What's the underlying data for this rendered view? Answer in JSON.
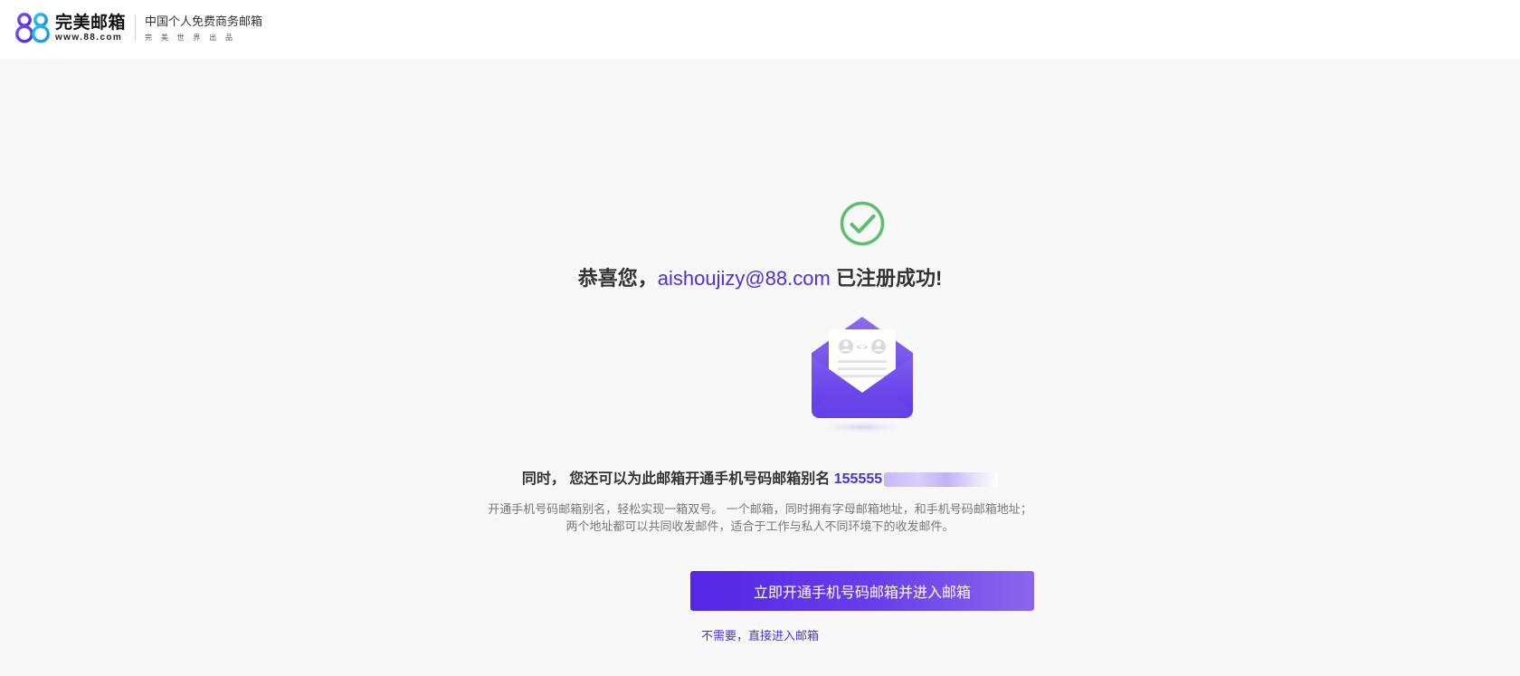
{
  "header": {
    "logo_mark": "88",
    "logo_name": "完美邮箱",
    "logo_domain": "www.88.com",
    "slogan": "中国个人免费商务邮箱",
    "slogan_sub": "完美世界出品"
  },
  "main": {
    "icon": "check-circle-icon",
    "title_prefix": "恭喜您，",
    "email": "aishoujizy@88.com",
    "title_suffix": " 已注册成功!",
    "envelope_icon": "envelope-icon",
    "alias_prefix": "同时， 您还可以为此邮箱开通手机号码邮箱别名 ",
    "alias_visible": "155555",
    "desc_line1": "开通手机号码邮箱别名，轻松实现一箱双号。 一个邮箱，同时拥有字母邮箱地址，和手机号码邮箱地址；",
    "desc_line2": "两个地址都可以共同收发邮件，适合于工作与私人不同环境下的收发邮件。",
    "cta_label": "立即开通手机号码邮箱并进入邮箱",
    "skip_label": "不需要，直接进入邮箱"
  },
  "colors": {
    "accent": "#4f2ee0",
    "success": "#5cbf6e",
    "background": "#f8f8f8"
  }
}
